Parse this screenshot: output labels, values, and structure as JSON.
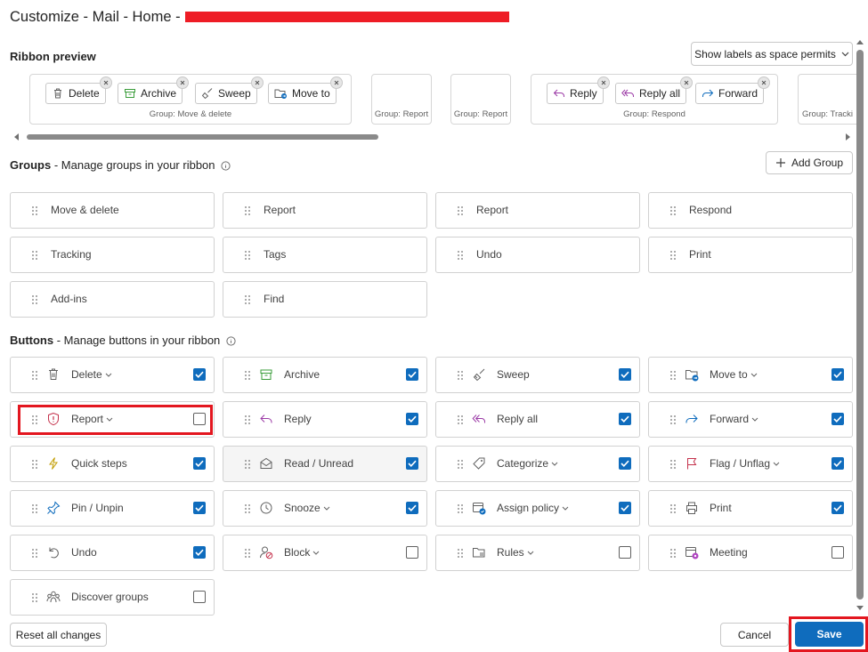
{
  "window": {
    "title": "Customize - Mail - Home -"
  },
  "ribbon_preview": {
    "heading": "Ribbon preview",
    "label_mode": "Show labels as space permits",
    "groups": [
      {
        "label": "Group: Move & delete",
        "buttons": [
          {
            "label": "Delete",
            "icon": "trash-icon"
          },
          {
            "label": "Archive",
            "icon": "archive-icon"
          },
          {
            "label": "Sweep",
            "icon": "broom-icon"
          },
          {
            "label": "Move to",
            "icon": "folder-move-icon"
          }
        ]
      },
      {
        "label": "Group: Report",
        "buttons": []
      },
      {
        "label": "Group: Report",
        "buttons": []
      },
      {
        "label": "Group: Respond",
        "buttons": [
          {
            "label": "Reply",
            "icon": "reply-icon"
          },
          {
            "label": "Reply all",
            "icon": "reply-all-icon"
          },
          {
            "label": "Forward",
            "icon": "forward-icon"
          }
        ]
      },
      {
        "label": "Group: Tracki",
        "buttons": []
      }
    ]
  },
  "groups_section": {
    "heading_bold": "Groups",
    "heading_rest": " - Manage groups in your ribbon",
    "add_group_label": "Add Group",
    "items": [
      "Move & delete",
      "Report",
      "Report",
      "Respond",
      "Tracking",
      "Tags",
      "Undo",
      "Print",
      "Add-ins",
      "Find"
    ]
  },
  "buttons_section": {
    "heading_bold": "Buttons",
    "heading_rest": " - Manage buttons in your ribbon",
    "items": [
      {
        "label": "Delete",
        "dropdown": true,
        "checked": true,
        "icon": "trash-icon"
      },
      {
        "label": "Archive",
        "dropdown": false,
        "checked": true,
        "icon": "archive-icon"
      },
      {
        "label": "Sweep",
        "dropdown": false,
        "checked": true,
        "icon": "broom-icon"
      },
      {
        "label": "Move to",
        "dropdown": true,
        "checked": true,
        "icon": "folder-move-icon"
      },
      {
        "label": "Report",
        "dropdown": true,
        "checked": false,
        "icon": "shield-alert-icon"
      },
      {
        "label": "Reply",
        "dropdown": false,
        "checked": true,
        "icon": "reply-icon"
      },
      {
        "label": "Reply all",
        "dropdown": false,
        "checked": true,
        "icon": "reply-all-icon"
      },
      {
        "label": "Forward",
        "dropdown": true,
        "checked": true,
        "icon": "forward-icon"
      },
      {
        "label": "Quick steps",
        "dropdown": false,
        "checked": true,
        "icon": "lightning-icon"
      },
      {
        "label": "Read / Unread",
        "dropdown": false,
        "checked": true,
        "icon": "envelope-open-icon"
      },
      {
        "label": "Categorize",
        "dropdown": true,
        "checked": true,
        "icon": "tag-icon"
      },
      {
        "label": "Flag / Unflag",
        "dropdown": true,
        "checked": true,
        "icon": "flag-icon"
      },
      {
        "label": "Pin / Unpin",
        "dropdown": false,
        "checked": true,
        "icon": "pin-icon"
      },
      {
        "label": "Snooze",
        "dropdown": true,
        "checked": true,
        "icon": "clock-icon"
      },
      {
        "label": "Assign policy",
        "dropdown": true,
        "checked": true,
        "icon": "calendar-policy-icon"
      },
      {
        "label": "Print",
        "dropdown": false,
        "checked": true,
        "icon": "printer-icon"
      },
      {
        "label": "Undo",
        "dropdown": false,
        "checked": true,
        "icon": "undo-icon"
      },
      {
        "label": "Block",
        "dropdown": true,
        "checked": false,
        "icon": "block-user-icon"
      },
      {
        "label": "Rules",
        "dropdown": true,
        "checked": false,
        "icon": "folder-rules-icon"
      },
      {
        "label": "Meeting",
        "dropdown": false,
        "checked": false,
        "icon": "meeting-calendar-icon"
      },
      {
        "label": "Discover groups",
        "dropdown": false,
        "checked": false,
        "icon": "people-group-icon"
      }
    ]
  },
  "footer": {
    "reset_label": "Reset all changes",
    "cancel_label": "Cancel",
    "save_label": "Save"
  },
  "colors": {
    "accent": "#0f6cbd",
    "highlight": "#e3161f",
    "redaction": "#ee1c25"
  }
}
